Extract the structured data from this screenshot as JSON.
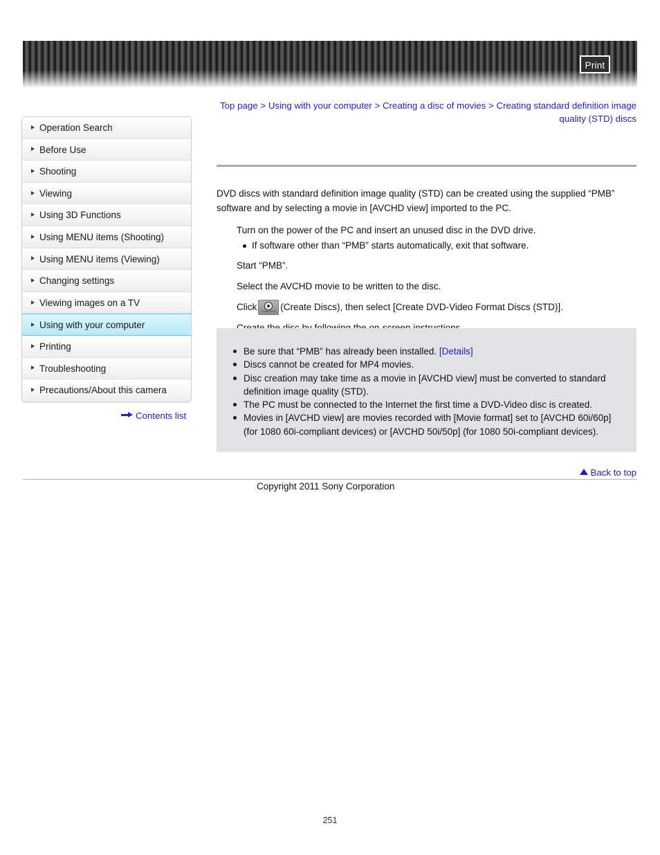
{
  "header": {
    "print_label": "Print"
  },
  "breadcrumb": {
    "items": [
      {
        "label": "Top page"
      },
      {
        "label": "Using with your computer"
      },
      {
        "label": "Creating a disc of movies"
      },
      {
        "label": "Creating standard definition image quality (STD) discs"
      }
    ],
    "separator": ">"
  },
  "sidebar": {
    "items": [
      {
        "label": "Operation Search",
        "selected": false
      },
      {
        "label": "Before Use",
        "selected": false
      },
      {
        "label": "Shooting",
        "selected": false
      },
      {
        "label": "Viewing",
        "selected": false
      },
      {
        "label": "Using 3D Functions",
        "selected": false
      },
      {
        "label": "Using MENU items (Shooting)",
        "selected": false
      },
      {
        "label": "Using MENU items (Viewing)",
        "selected": false
      },
      {
        "label": "Changing settings",
        "selected": false
      },
      {
        "label": "Viewing images on a TV",
        "selected": false
      },
      {
        "label": "Using with your computer",
        "selected": true
      },
      {
        "label": "Printing",
        "selected": false
      },
      {
        "label": "Troubleshooting",
        "selected": false
      },
      {
        "label": "Precautions/About this camera",
        "selected": false
      }
    ],
    "contents_list_label": "Contents list"
  },
  "main": {
    "intro": "DVD discs with standard definition image quality (STD) can be created using the supplied “PMB” software and by selecting a movie in [AVCHD view] imported to the PC.",
    "steps": [
      {
        "text": "Turn on the power of the PC and insert an unused disc in the DVD drive.",
        "substeps": [
          "If software other than “PMB” starts automatically, exit that software."
        ]
      },
      {
        "text": "Start “PMB”.",
        "substeps": []
      },
      {
        "text": "Select the AVCHD movie to be written to the disc.",
        "substeps": []
      },
      {
        "text_before_icon": "Click",
        "icon": "create-discs-icon",
        "icon_caption": "Create Discs",
        "text_after_icon": "(Create Discs), then select [Create DVD-Video Format Discs (STD)].",
        "substeps": []
      },
      {
        "text": "Create the disc by following the on-screen instructions.",
        "substeps": []
      }
    ]
  },
  "notes": {
    "items": [
      {
        "text": "Be sure that “PMB” has already been installed.",
        "link": "[Details]"
      },
      {
        "text": "Discs cannot be created for MP4 movies.",
        "link": ""
      },
      {
        "text": "Disc creation may take time as a movie in [AVCHD view] must be converted to standard definition image quality (STD).",
        "link": ""
      },
      {
        "text": "The PC must be connected to the Internet the first time a DVD-Video disc is created.",
        "link": ""
      },
      {
        "text": "Movies in [AVCHD view] are movies recorded with [Movie format] set to [AVCHD 60i/60p] (for 1080 60i-compliant devices) or [AVCHD 50i/50p] (for 1080 50i-compliant devices).",
        "link": ""
      }
    ]
  },
  "footer": {
    "back_to_top_label": "Back to top",
    "copyright": "Copyright 2011 Sony Corporation",
    "page_number": "251"
  },
  "colors": {
    "link": "#2222bb",
    "selected_item": "#c9f0fa",
    "notes_background": "#e0e2e5",
    "header_banner": "#2b2b2b"
  }
}
